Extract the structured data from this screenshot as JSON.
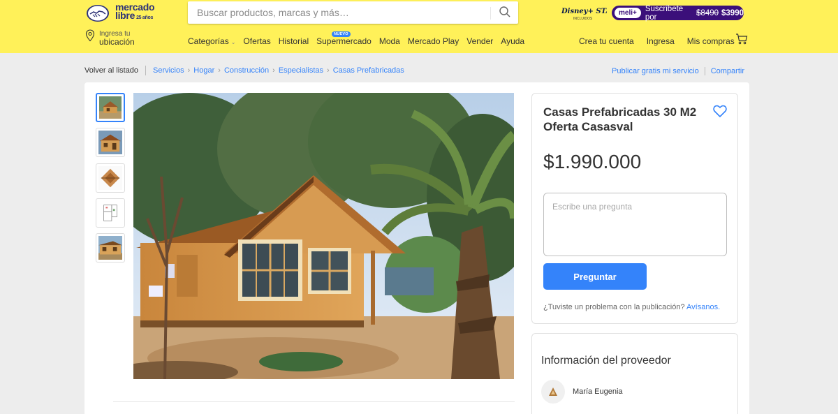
{
  "header": {
    "logo_line1": "mercado",
    "logo_line2": "libre",
    "logo_anos": "25 años",
    "search_placeholder": "Buscar productos, marcas y más…",
    "disney_label": "Disney+ STAR+",
    "disney_sub": "INCLUIDOS",
    "promo_chip": "meli+",
    "promo_text": "Suscribete por",
    "promo_old": "$8490",
    "promo_new": "$3990",
    "location_line1": "Ingresa tu",
    "location_line2": "ubicación",
    "nav": [
      "Categorías",
      "Ofertas",
      "Historial",
      "Supermercado",
      "Moda",
      "Mercado Play",
      "Vender",
      "Ayuda"
    ],
    "nuevo_badge": "NUEVO",
    "account": [
      "Crea tu cuenta",
      "Ingresa",
      "Mis compras"
    ],
    "brand_color": "#fff159",
    "accent_color": "#3483fa"
  },
  "breadcrumb": {
    "back": "Volver al listado",
    "items": [
      "Servicios",
      "Hogar",
      "Construcción",
      "Especialistas",
      "Casas Prefabricadas"
    ],
    "publish": "Publicar gratis mi servicio",
    "share": "Compartir"
  },
  "listing": {
    "title": "Casas Prefabricadas 30 M2 Oferta Casasval",
    "price": "$1.990.000",
    "question_placeholder": "Escribe una pregunta",
    "ask_button": "Preguntar",
    "report_text": "¿Tuviste un problema con la publicación?",
    "report_link": "Avísanos."
  },
  "provider": {
    "heading": "Información del proveedor",
    "name": "María Eugenia"
  }
}
